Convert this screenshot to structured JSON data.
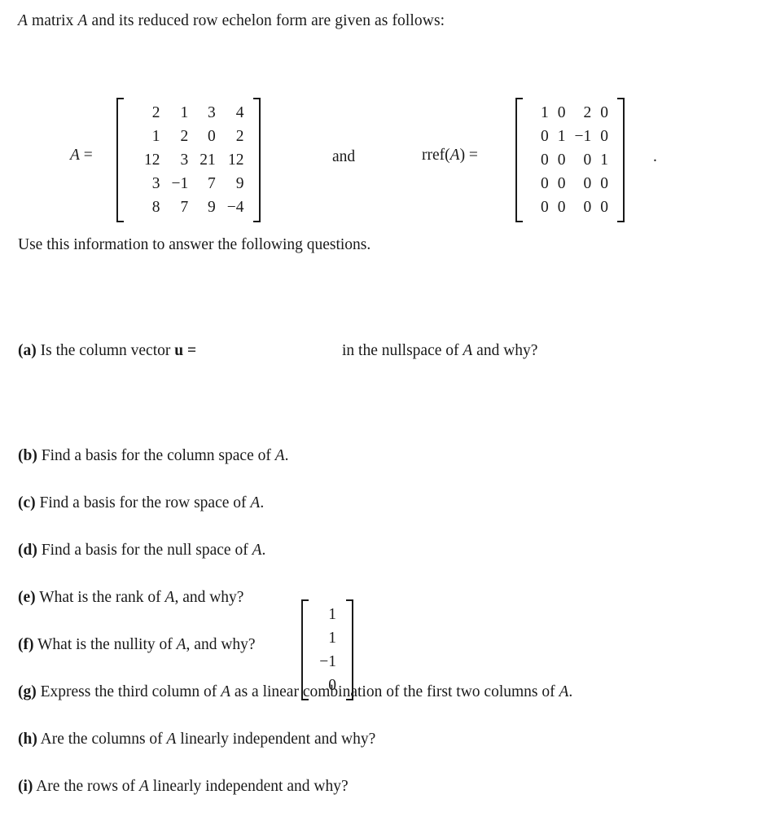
{
  "document": {
    "intro": "A matrix A and its reduced row echelon form are given as follows:",
    "use_information": "Use this information to answer the following questions.",
    "trailing_period": "."
  },
  "labels": {
    "matrix_a": "A =",
    "and": "and",
    "rref": "rref(A) ="
  },
  "matrices": {
    "A": {
      "name": "A",
      "rows": 5,
      "cols": 4,
      "values": [
        [
          "2",
          "1",
          "3",
          "4"
        ],
        [
          "1",
          "2",
          "0",
          "2"
        ],
        [
          "12",
          "3",
          "21",
          "12"
        ],
        [
          "3",
          "−1",
          "7",
          "9"
        ],
        [
          "8",
          "7",
          "9",
          "−4"
        ]
      ]
    },
    "rref_A": {
      "name": "rref(A)",
      "rows": 5,
      "cols": 4,
      "values": [
        [
          "1",
          "0",
          "2",
          "0"
        ],
        [
          "0",
          "1",
          "−1",
          "0"
        ],
        [
          "0",
          "0",
          "0",
          "1"
        ],
        [
          "0",
          "0",
          "0",
          "0"
        ],
        [
          "0",
          "0",
          "0",
          "0"
        ]
      ]
    },
    "vector_u": {
      "name": "u",
      "rows": 4,
      "cols": 1,
      "values": [
        [
          "1"
        ],
        [
          "1"
        ],
        [
          "−1"
        ],
        [
          "0"
        ]
      ]
    }
  },
  "question_a": {
    "tag": "(a)",
    "lead": "Is the column vector",
    "symbol": "u =",
    "tail": "in the nullspace of A and why?"
  },
  "questions": [
    {
      "tag": "(b)",
      "text": "Find a basis for the column space of A."
    },
    {
      "tag": "(c)",
      "text": "Find a basis for the row space of A."
    },
    {
      "tag": "(d)",
      "text": "Find a basis for the null space of A."
    },
    {
      "tag": "(e)",
      "text": "What is the rank of A, and why?"
    },
    {
      "tag": "(f)",
      "text": "What is the nullity of A, and why?"
    },
    {
      "tag": "(g)",
      "text": "Express the third column of A as a linear combination of the first two columns of A."
    },
    {
      "tag": "(h)",
      "text": "Are the columns of A linearly independent and why?"
    },
    {
      "tag": "(i)",
      "text": "Are the rows of A linearly independent and why?"
    }
  ],
  "colors": {
    "background": "#ffffff",
    "text": "#1a1a1a"
  }
}
